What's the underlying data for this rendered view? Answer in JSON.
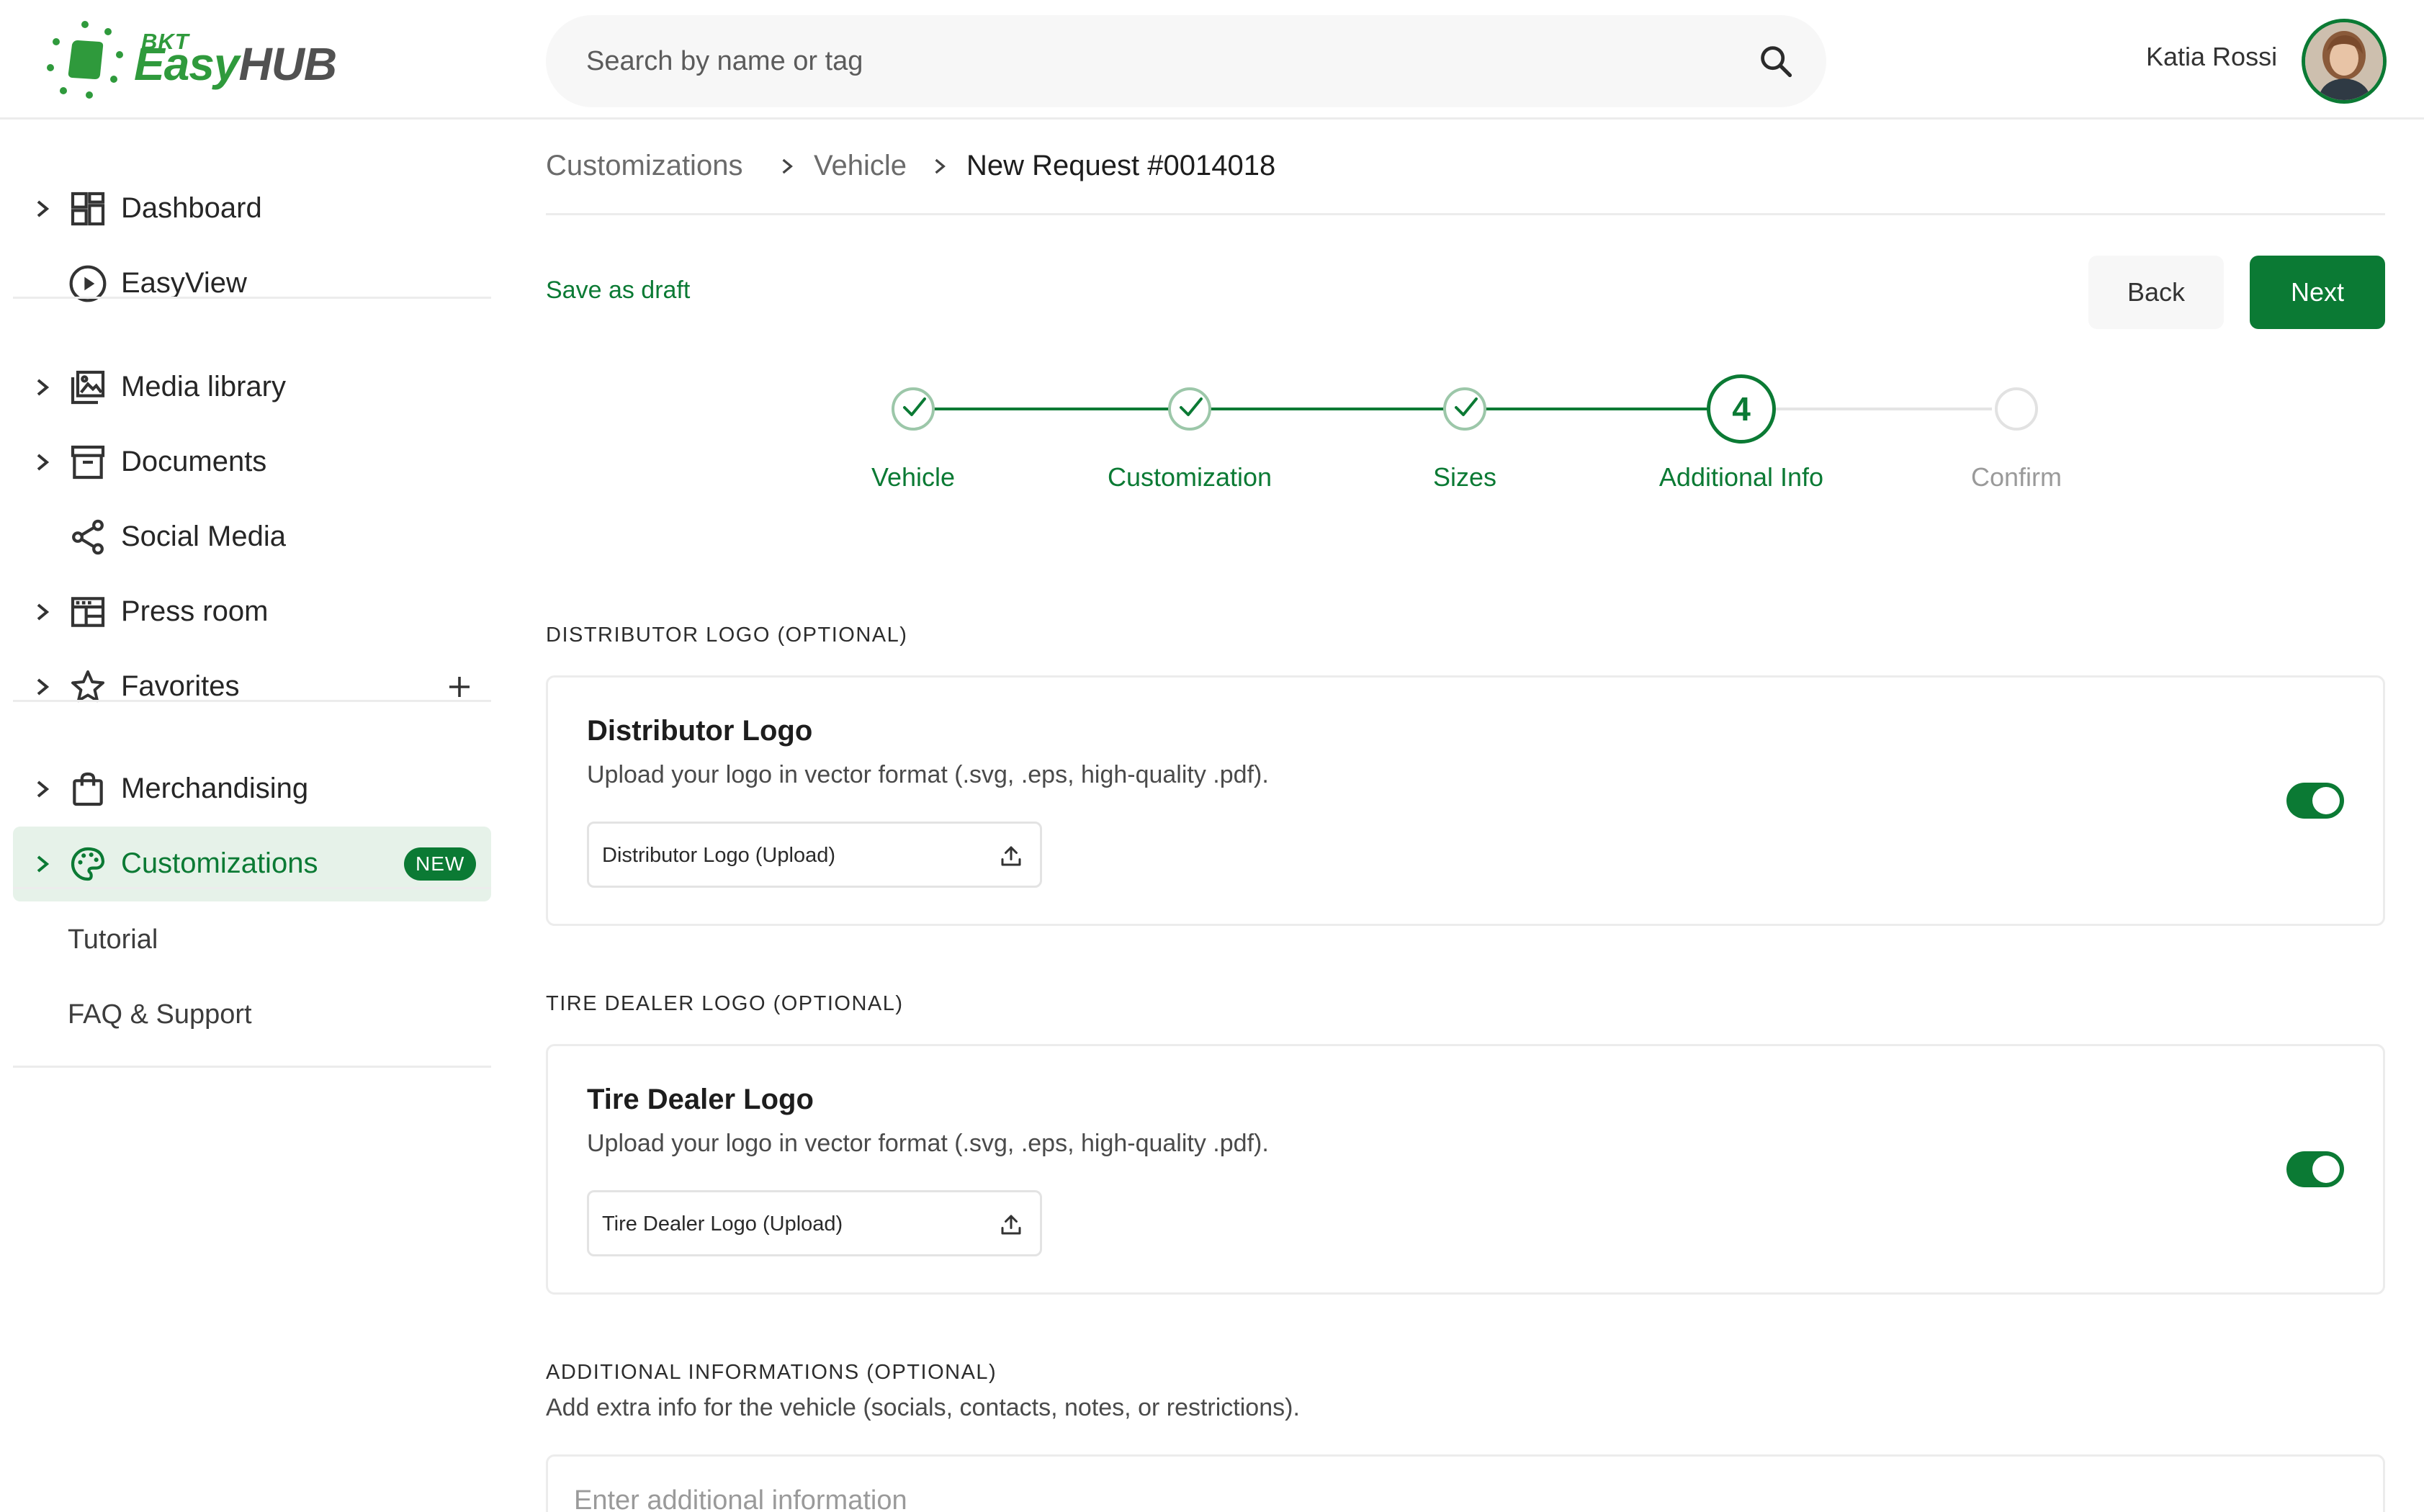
{
  "brand": {
    "prefix": "BKT",
    "name_part1": "Easy",
    "name_part2": "HUB",
    "green": "#2f9a3c",
    "gray": "#515151"
  },
  "theme": {
    "accent": "#0b7a34",
    "accent_light": "#e6f2e9"
  },
  "search": {
    "placeholder": "Search by name or tag"
  },
  "user": {
    "name": "Katia Rossi"
  },
  "sidebar": {
    "items": [
      {
        "label": "Dashboard",
        "icon": "dashboard-icon",
        "expandable": true
      },
      {
        "label": "EasyView",
        "icon": "play-circle-icon",
        "expandable": false
      },
      {
        "label": "Media library",
        "icon": "photo-library-icon",
        "expandable": true
      },
      {
        "label": "Documents",
        "icon": "archive-icon",
        "expandable": true
      },
      {
        "label": "Social Media",
        "icon": "share-icon",
        "expandable": false
      },
      {
        "label": "Press room",
        "icon": "newspaper-icon",
        "expandable": true
      },
      {
        "label": "Favorites",
        "icon": "star-icon",
        "expandable": true,
        "action": "plus-icon"
      },
      {
        "label": "Merchandising",
        "icon": "shopping-bag-icon",
        "expandable": true
      },
      {
        "label": "Customizations",
        "icon": "palette-icon",
        "expandable": true,
        "active": true,
        "badge": "NEW"
      }
    ],
    "footer_links": [
      {
        "label": "Tutorial"
      },
      {
        "label": "FAQ & Support"
      }
    ]
  },
  "breadcrumb": [
    "Customizations",
    "Vehicle",
    "New Request #0014018"
  ],
  "actions": {
    "save_draft": "Save as draft",
    "back": "Back",
    "next": "Next"
  },
  "stepper": {
    "current_step": 4,
    "steps": [
      {
        "label": "Vehicle",
        "state": "done"
      },
      {
        "label": "Customization",
        "state": "done"
      },
      {
        "label": "Sizes",
        "state": "done"
      },
      {
        "label": "Additional Info",
        "state": "current",
        "number": "4"
      },
      {
        "label": "Confirm",
        "state": "todo"
      }
    ]
  },
  "sections": {
    "distributor": {
      "heading": "DISTRIBUTOR LOGO (OPTIONAL)",
      "title": "Distributor Logo",
      "description": "Upload your logo in vector format (.svg, .eps, high-quality .pdf).",
      "upload_label": "Distributor Logo (Upload)",
      "enabled": true
    },
    "tire_dealer": {
      "heading": "TIRE DEALER LOGO (OPTIONAL)",
      "title": "Tire Dealer Logo",
      "description": "Upload your logo in vector format (.svg, .eps, high-quality .pdf).",
      "upload_label": "Tire Dealer Logo (Upload)",
      "enabled": true
    },
    "additional": {
      "heading": "ADDITIONAL INFORMATIONS (OPTIONAL)",
      "description": "Add extra info for the vehicle (socials, contacts, notes, or restrictions).",
      "placeholder": "Enter additional information"
    }
  }
}
